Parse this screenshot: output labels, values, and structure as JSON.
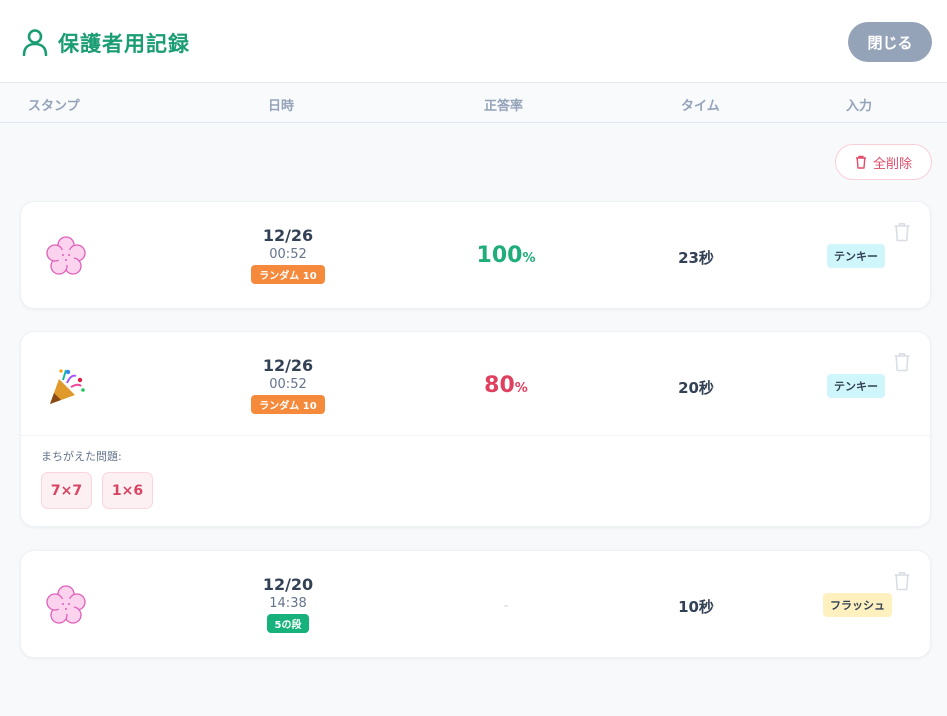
{
  "header": {
    "title": "保護者用記録",
    "close_label": "閉じる"
  },
  "columns": [
    "スタンプ",
    "日時",
    "正答率",
    "タイム",
    "入力"
  ],
  "clear_all_label": "全削除",
  "records": [
    {
      "stamp": "flower-stamp",
      "date": "12/26",
      "time": "00:52",
      "mode": "ランダム 10",
      "mode_color": "#f58a3c",
      "rate_value": "100",
      "rate_unit": "%",
      "rate_color": "#1fae7a",
      "duration": "23秒",
      "input": "テンキー",
      "input_color": "#cff6fb"
    },
    {
      "stamp": "party-popper-stamp",
      "date": "12/26",
      "time": "00:52",
      "mode": "ランダム 10",
      "mode_color": "#f58a3c",
      "rate_value": "80",
      "rate_unit": "%",
      "rate_color": "#e0405f",
      "duration": "20秒",
      "input": "テンキー",
      "input_color": "#cff6fb",
      "mistakes_label": "まちがえた問題:",
      "mistakes": [
        "7×7",
        "1×6"
      ]
    },
    {
      "stamp": "flower-stamp",
      "date": "12/20",
      "time": "14:38",
      "mode": "5の段",
      "mode_color": "#17b27c",
      "rate_dash": "-",
      "duration": "10秒",
      "input": "フラッシュ",
      "input_color": "#fef0bf"
    }
  ],
  "colors": {
    "accent": "#1a9d72",
    "danger": "#e14c6a",
    "muted": "#94a3b8"
  }
}
